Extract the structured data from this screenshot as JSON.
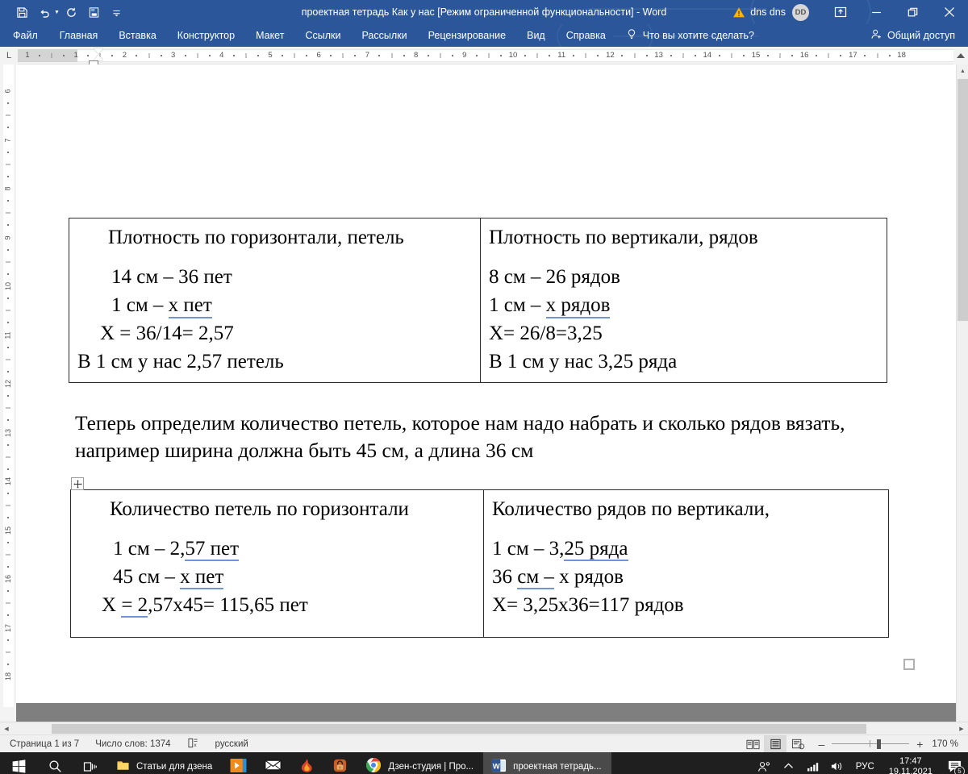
{
  "titlebar": {
    "title": "проектная тетрадь  Как у нас [Режим ограниченной функциональности]  -  Word",
    "account_name": "dns dns",
    "avatar_initials": "DD",
    "qat": [
      {
        "name": "save-icon",
        "label": "Сохранить"
      },
      {
        "name": "undo-icon",
        "label": "Отменить"
      },
      {
        "name": "redo-icon",
        "label": "Вернуть"
      },
      {
        "name": "print-preview-icon",
        "label": "Предварительный просмотр и печать"
      },
      {
        "name": "customize-qat-icon",
        "label": "Настройка панели быстрого доступа"
      }
    ],
    "window_buttons": [
      {
        "name": "ribbon-display-options-button",
        "glyph": "⊞"
      },
      {
        "name": "minimize-button",
        "glyph": "—"
      },
      {
        "name": "restore-button",
        "glyph": "❐"
      },
      {
        "name": "close-button",
        "glyph": "✕"
      }
    ]
  },
  "ribbon": {
    "tabs": [
      "Файл",
      "Главная",
      "Вставка",
      "Конструктор",
      "Макет",
      "Ссылки",
      "Рассылки",
      "Рецензирование",
      "Вид",
      "Справка"
    ],
    "tellme_placeholder": "Что вы хотите сделать?",
    "share_label": "Общий доступ"
  },
  "ruler": {
    "tab_selector": "L",
    "horizontal_ticks": [
      "1",
      "1",
      "2",
      "3",
      "4",
      "5",
      "6",
      "7",
      "8",
      "9",
      "10",
      "11",
      "12",
      "13",
      "14",
      "15",
      "16",
      "17",
      "18"
    ],
    "vertical_ticks": [
      "6",
      "7",
      "8",
      "9",
      "10",
      "11",
      "12",
      "13",
      "14",
      "15",
      "16",
      "17",
      "18"
    ]
  },
  "document": {
    "table1": {
      "left": {
        "header": "Плотность по горизонтали, петель",
        "lines": [
          {
            "prefix": "14 см – 36 пет",
            "err": "",
            "suffix": ""
          },
          {
            "prefix": "1 см  –  ",
            "err": "х  пет",
            "err_type": "spell",
            "suffix": ""
          },
          {
            "prefix": "X = 36/14= 2,57",
            "err": "",
            "suffix": ""
          }
        ],
        "last": "В 1 см у нас 2,57 петель"
      },
      "right": {
        "header": "Плотность по вертикали, рядов",
        "lines": [
          {
            "prefix": "8 см – 26 рядов",
            "err": "",
            "suffix": ""
          },
          {
            "prefix": "1 см – ",
            "err": "х  рядов",
            "err_type": "spell",
            "suffix": ""
          },
          {
            "prefix": "X= 26/8=3,25",
            "err": "",
            "suffix": ""
          }
        ],
        "last": "В 1 см у нас 3,25 ряда"
      }
    },
    "paragraph": "Теперь определим количество петель, которое нам надо набрать и сколько рядов вязать, например ширина должна быть 45 см, а длина 36 см",
    "table2": {
      "left": {
        "header": "Количество петель по горизонтали",
        "lines": [
          {
            "prefix": "1 см  –  2,",
            "err": "57  пет",
            "err_type": "grammar",
            "suffix": ""
          },
          {
            "prefix": "45 см –  ",
            "err": "х  пет",
            "err_type": "grammar",
            "suffix": ""
          },
          {
            "prefix": "X ",
            "err": "=  2",
            "err_type": "grammar",
            "suffix": ",57x45= 115,65 пет"
          }
        ]
      },
      "right": {
        "header": "Количество рядов по вертикали,",
        "lines": [
          {
            "prefix": "1 см – 3,",
            "err": "25  ряда",
            "err_type": "grammar",
            "suffix": ""
          },
          {
            "prefix": "36 ",
            "err": "см  –",
            "err_type": "grammar",
            "suffix": " х  рядов"
          },
          {
            "prefix": "X= 3,25x36=117 рядов",
            "err": "",
            "suffix": ""
          }
        ]
      }
    }
  },
  "statusbar": {
    "page": "Страница 1 из 7",
    "words": "Число слов: 1374",
    "proofing_icon": "proofing-errors-icon",
    "language": "русский",
    "views": [
      {
        "name": "read-mode-button",
        "active": false
      },
      {
        "name": "print-layout-button",
        "active": true
      },
      {
        "name": "web-layout-button",
        "active": false
      }
    ],
    "zoom_minus": "–",
    "zoom_plus": "+",
    "zoom_value": "170 %"
  },
  "taskbar": {
    "start_label": "Пуск",
    "search_label": "Поиск",
    "taskview_label": "Представление задач",
    "items": [
      {
        "name": "taskbar-item-folder",
        "label": "Статьи для дзена",
        "icon": "folder-icon",
        "state": "open"
      },
      {
        "name": "taskbar-item-media",
        "label": "",
        "icon": "media-player-icon",
        "state": "pinned"
      },
      {
        "name": "taskbar-item-mail",
        "label": "",
        "icon": "mail-icon",
        "state": "pinned"
      },
      {
        "name": "taskbar-item-flame",
        "label": "",
        "icon": "flame-icon",
        "state": "pinned"
      },
      {
        "name": "taskbar-item-lock",
        "label": "",
        "icon": "lock-icon",
        "state": "pinned"
      },
      {
        "name": "taskbar-item-chrome",
        "label": "Дзен-студия | Про...",
        "icon": "chrome-icon",
        "state": "open"
      },
      {
        "name": "taskbar-item-word",
        "label": "проектная тетрадь...",
        "icon": "word-icon",
        "state": "active"
      }
    ],
    "tray": {
      "people_icon": "people-icon",
      "chevron_icon": "chevron-up-icon",
      "network_icon": "network-signal-icon",
      "volume_icon": "volume-icon",
      "language": "РУС",
      "time": "17:47",
      "date": "19.11.2021",
      "notifications_count": "5"
    }
  },
  "colors": {
    "word_blue": "#2b579a",
    "taskbar": "#1f1f1f",
    "page_gray": "#7f7f7f",
    "spellcheck_blue": "#6f95d8"
  }
}
